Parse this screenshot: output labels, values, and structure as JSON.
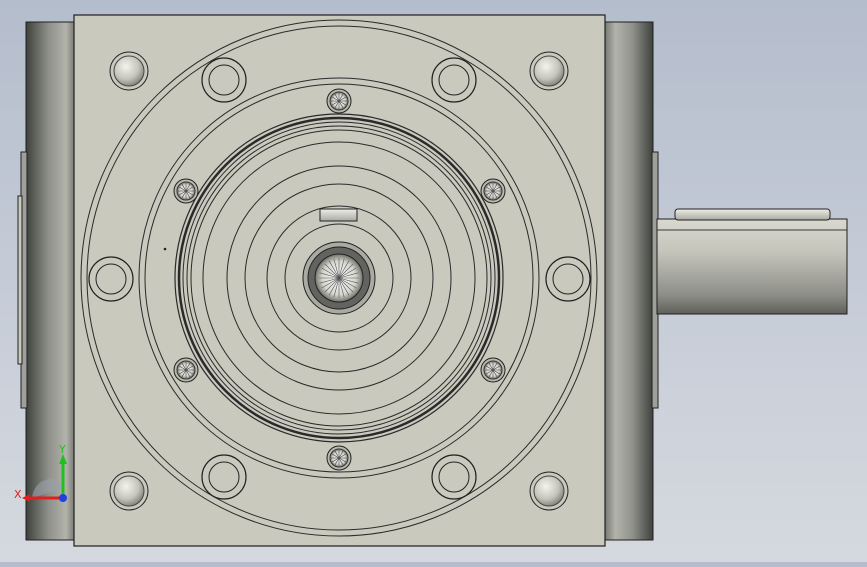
{
  "viewport": {
    "model_name": "gearbox-right-angle-reducer",
    "background_top": "#b4bdcc",
    "background_bottom": "#d5d9df",
    "body_color": "#c9c9be",
    "edge_color": "#2a2a2a"
  },
  "triad": {
    "x_label": "X",
    "y_label": "Y",
    "x_color": "#e02020",
    "y_color": "#20c020",
    "z_color": "#2040e0"
  }
}
